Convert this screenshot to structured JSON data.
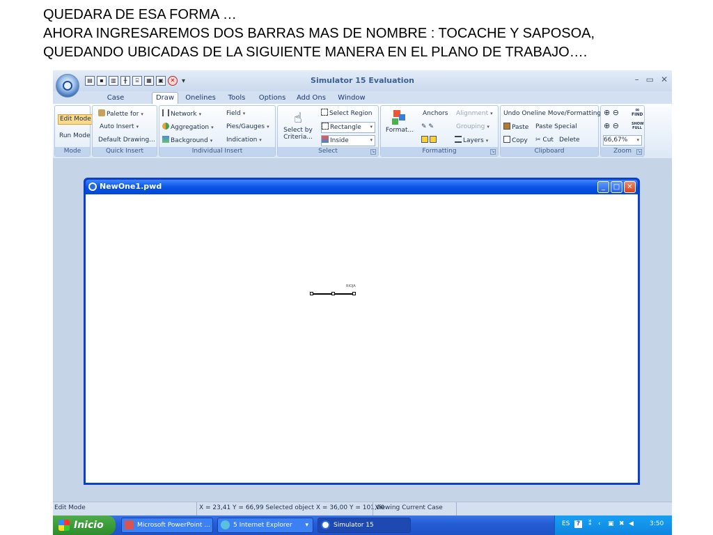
{
  "slide": {
    "line1": "QUEDARA DE ESA FORMA …",
    "line2": "AHORA INGRESAREMOS  DOS BARRAS MAS DE NOMBRE : TOCACHE Y SAPOSOA,",
    "line3": "QUEDANDO  UBICADAS DE LA SIGUIENTE MANERA EN EL PLANO DE TRABAJO…."
  },
  "app": {
    "title": "Simulator 15 Evaluation",
    "qat_more": "▾",
    "window_controls": {
      "minimize": "–",
      "restore": "▭",
      "close": "✕"
    },
    "help": "?"
  },
  "tabs": [
    "Case Information",
    "Draw",
    "Onelines",
    "Tools",
    "Options",
    "Add Ons",
    "Window"
  ],
  "active_tab": "Draw",
  "ribbon": {
    "mode": {
      "label": "Mode",
      "edit": "Edit Mode",
      "run": "Run Mode"
    },
    "quick_insert": {
      "label": "Quick Insert",
      "palette": "Palette for",
      "auto": "Auto Insert",
      "default": "Default Drawing..."
    },
    "individual_insert": {
      "label": "Individual Insert",
      "network": "Network",
      "aggregation": "Aggregation",
      "background": "Background",
      "field": "Field",
      "pies": "Pies/Gauges",
      "indication": "Indication"
    },
    "select": {
      "label": "Select",
      "select_by": "Select by",
      "criteria": "Criteria...",
      "region": "Select Region",
      "rectangle": "Rectangle",
      "inside": "Inside"
    },
    "formatting": {
      "label": "Formatting",
      "format": "Format...",
      "anchors": "Anchors",
      "alignment": "Alignment",
      "grouping": "Grouping",
      "layers": "Layers"
    },
    "clipboard": {
      "label": "Clipboard",
      "undo": "Undo Oneline Move/Formatting",
      "paste": "Paste",
      "paste_special": "Paste Special",
      "copy": "Copy",
      "cut": "Cut",
      "delete": "Delete"
    },
    "zoom": {
      "label": "Zoom",
      "value": "66,67%",
      "find": "FIND",
      "show_full": "SHOW FULL"
    }
  },
  "document": {
    "title": "NewOne1.pwd",
    "bus_label": "RIOJA"
  },
  "status": {
    "mode": "Edit Mode",
    "coords": "X = 23,41 Y = 66,99 Selected object X = 36,00 Y = 101,00",
    "case": "Viewing Current Case"
  },
  "taskbar": {
    "start": "Inicio",
    "tasks": [
      "Microsoft PowerPoint ...",
      "5 Internet Explorer",
      "Simulator 15"
    ],
    "lang": "ES",
    "time": "3:50"
  },
  "colors": {
    "taskbar": "#245dd6",
    "start": "#2d8c2b",
    "child_title": "#0a55e6"
  }
}
